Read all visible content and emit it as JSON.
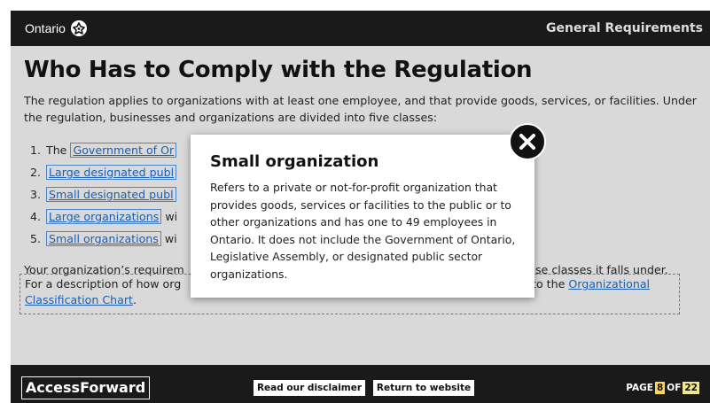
{
  "header": {
    "brand": "Ontario",
    "section_title": "General Requirements"
  },
  "main": {
    "title": "Who Has to Comply with the Regulation",
    "intro": "The regulation applies to organizations with at least one employee, and that provide goods, services, or facilities. Under the regulation, businesses and organizations are divided into five classes:",
    "list": [
      {
        "number": "1.",
        "prefix": "The ",
        "term": "Government of Or",
        "suffix": ""
      },
      {
        "number": "2.",
        "prefix": "",
        "term": "Large designated publ",
        "suffix": ""
      },
      {
        "number": "3.",
        "prefix": "",
        "term": "Small designated publ",
        "suffix": ""
      },
      {
        "number": "4.",
        "prefix": "",
        "term": "Large organizations",
        "suffix": " wi"
      },
      {
        "number": "5.",
        "prefix": "",
        "term": "Small organizations",
        "suffix": " wi"
      }
    ],
    "requirements_left": "Your organization’s requirem",
    "requirements_right": "se classes it falls under.",
    "description_left": "For a description of how org",
    "description_right_prefix": "to the ",
    "description_link_1": "Organizational",
    "description_link_2": "Classification Chart",
    "description_end": "."
  },
  "modal": {
    "title": "Small organization",
    "body": "Refers to a private or not-for-profit organization that provides goods, services or facilities to the public or to other organizations and has one to 49 employees in Ontario. It does not include the Government of Ontario, Legislative Assembly, or designated public sector organizations.",
    "close_icon": "close-icon"
  },
  "footer": {
    "logo": "AccessForward",
    "disclaimer_button": "Read our disclaimer",
    "return_button": "Return to website",
    "page_label": "PAGE",
    "page_current": "8",
    "page_of": "OF",
    "page_total": "22"
  },
  "colors": {
    "bar": "#1a1a1a",
    "content_bg": "#d9d9d9",
    "link": "#1a5fb4",
    "page_highlight": "#ffd54f"
  }
}
